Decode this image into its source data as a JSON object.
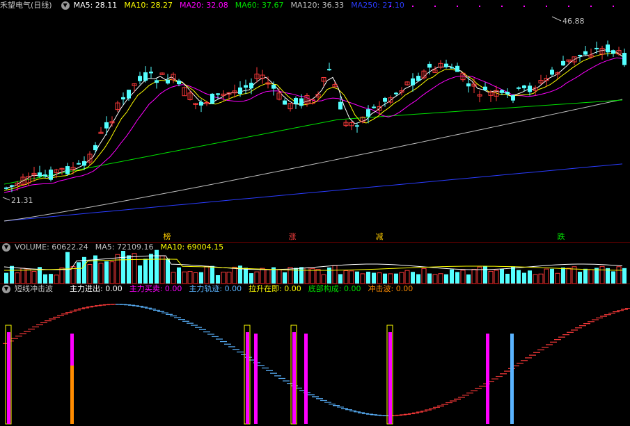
{
  "price_pane": {
    "title": "禾望电气(日线)",
    "ma_legend": [
      {
        "text": "MA5: 28.11",
        "color": "#ffffff"
      },
      {
        "text": "MA10: 28.27",
        "color": "#ffff00"
      },
      {
        "text": "MA20: 32.08",
        "color": "#ff00ff"
      },
      {
        "text": "MA60: 37.67",
        "color": "#00e000"
      },
      {
        "text": "MA120: 36.33",
        "color": "#c0c0c0"
      },
      {
        "text": "MA250: 27.10",
        "color": "#2a3cff"
      }
    ],
    "high_label": "46.88",
    "low_label": "21.31",
    "signals": [
      {
        "text": "榜",
        "color": "#ffcc00"
      },
      {
        "text": "涨",
        "color": "#ff4040"
      },
      {
        "text": "减",
        "color": "#ffcc00"
      },
      {
        "text": "跌",
        "color": "#00e000"
      }
    ]
  },
  "volume_pane": {
    "legend": [
      {
        "text": "VOLUME: 60622.24",
        "color": "#c0c0c0"
      },
      {
        "text": "MA5: 72109.16",
        "color": "#c0c0c0"
      },
      {
        "text": "MA10: 69004.15",
        "color": "#ffff00"
      }
    ]
  },
  "osc_pane": {
    "title": "短线冲击波",
    "legend": [
      {
        "text": "主力进出: 0.00",
        "color": "#ffffff"
      },
      {
        "text": "主力买卖: 0.00",
        "color": "#ff00ff"
      },
      {
        "text": "主力轨迹: 0.00",
        "color": "#5ab4ff"
      },
      {
        "text": "拉升在即: 0.00",
        "color": "#ffff00"
      },
      {
        "text": "底部构成: 0.00",
        "color": "#00e000"
      },
      {
        "text": "冲击波: 0.00",
        "color": "#ff8c00"
      }
    ]
  },
  "colors": {
    "up": "#ff3a3a",
    "down": "#54ffff",
    "grid": "#7a0000",
    "ma5": "#ffffff",
    "ma10": "#ffff00",
    "ma20": "#ff00ff",
    "ma60": "#00e000",
    "ma120": "#c0c0c0",
    "ma250": "#2a3cff"
  }
}
